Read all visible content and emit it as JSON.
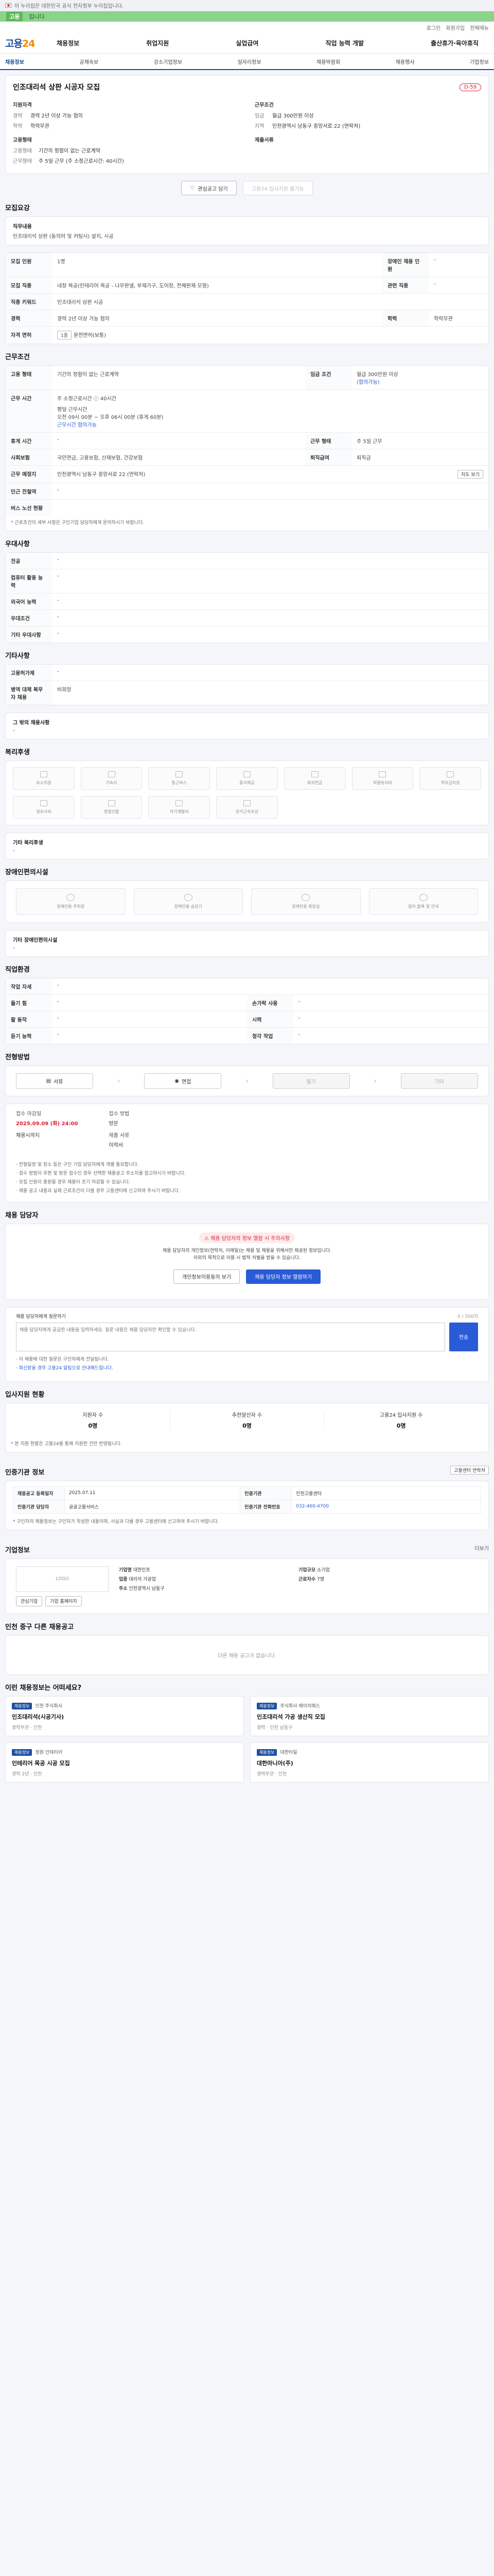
{
  "gov_bar": {
    "text": "이 누리집은 대한민국 공식 전자정부 누리집입니다."
  },
  "stripe": {
    "label": "고용",
    "text": "입니다"
  },
  "utility": {
    "links": [
      "로그인",
      "회원가입",
      "전체메뉴"
    ]
  },
  "gnb": {
    "logo": "고용",
    "logo_num": "24",
    "menu": [
      "채용정보",
      "취업지원",
      "실업급여",
      "직업 능력 개발",
      "출산휴가·육아휴직"
    ]
  },
  "sub_tabs": [
    "채용정보",
    "공채속보",
    "강소기업정보",
    "일자리정보",
    "채용박람회",
    "채용행사",
    "기업정보"
  ],
  "posting": {
    "title": "인조대리석 상판 시공자 모집",
    "dday": "D-59",
    "qual_head": "지원자격",
    "work_head": "근무조건",
    "company_head": "고용형태",
    "place_head": "제출서류",
    "qual": [
      {
        "k": "경력",
        "v": "경력 2년 이상 가능 협의"
      },
      {
        "k": "학력",
        "v": "학력무관"
      }
    ],
    "work": [
      {
        "k": "임금",
        "v": "월급 300만원 이상"
      },
      {
        "k": "지역",
        "v": "인천광역시 남동구 중앙서로 22 (연락처)"
      }
    ],
    "emp": [
      {
        "k": "고용형태",
        "v": "기간의 정함이 없는 근로계약"
      },
      {
        "k": "근무형태",
        "v": "주 5일 근무 (주 소정근로시간: 40시간)"
      }
    ],
    "buttons": {
      "scrap": "관심공고 담기",
      "apply": "고용24 입사지원 불가능"
    }
  },
  "recruit": {
    "section": "모집요강",
    "job_lbl": "직무내용",
    "job_val": "인조대리석 상판 (동의어 및 커팅시) 설치, 시공",
    "rows": [
      {
        "k": "모집 인원",
        "v": "1명",
        "k2": "장애인 채용 인원",
        "v2": "-"
      },
      {
        "k": "모집 직종",
        "v": "내장 목공(인테리어 목공 - 나무판넬, 부재가구, 도어장, 전체판재 모형)",
        "k2": "관련 직종",
        "v2": "-"
      },
      {
        "k": "직종 키워드",
        "v": "인조대리석 상판 시공",
        "k2": "",
        "v2": ""
      },
      {
        "k": "경력",
        "v": "경력 2년 이상 가능 협의",
        "k2": "학력",
        "v2": "학력무관"
      },
      {
        "k": "자격 면허",
        "v": "운전면허(보통)",
        "k2": "",
        "v2": ""
      }
    ]
  },
  "conditions": {
    "section": "근무조건",
    "emp_type_k": "고용 형태",
    "emp_type_v": "기간의 정함이 없는 근로계약",
    "wage_k": "임금 조건",
    "wage_v": "월급 300만원 이상",
    "wage_note": "(협의가능)",
    "time_k": "근무 시간",
    "time_lines": [
      "주 소정근로시간 ⓘ 40시간",
      "평일 근무시간",
      "오전 09시 00분 ~ 오후 06시 00분 (휴게 60분)",
      "근무시간 협의가능"
    ],
    "social_k": "휴게 시간",
    "social_v": "-",
    "workday_k": "근무 형태",
    "workday_v": "주 5일 근무",
    "insurance_k": "사회보험",
    "insurance_v": "국민연금, 고용보험, 산재보험, 건강보험",
    "retire_k": "퇴직급여",
    "retire_v": "퇴직금",
    "place_k": "근무 예정지",
    "place_v": "인천광역시 남동구 중앙서로 22 (연락처)",
    "map_btn": "지도 보기",
    "nearby_k": "인근 전철역",
    "nearby_v": "-",
    "bus_k": "버스 노선 현황",
    "note": "* 근로조건의 세부 사항은 구인기업 담당자에게 문의하시기 바랍니다."
  },
  "preferred": {
    "section": "우대사항",
    "rows": [
      {
        "k": "전공",
        "v": "-"
      },
      {
        "k": "컴퓨터 활용 능력",
        "v": "-"
      },
      {
        "k": "외국어 능력",
        "v": "-"
      },
      {
        "k": "우대조건",
        "v": "-"
      },
      {
        "k": "기타 우대사항",
        "v": "-"
      }
    ]
  },
  "etc": {
    "section": "기타사항",
    "rows": [
      {
        "k": "고용허가제",
        "v": "-"
      },
      {
        "k": "병역 대체 복무자 채용",
        "v": "비희망"
      }
    ],
    "extra_lbl": "그 밖의 채용사항",
    "extra_val": "-"
  },
  "benefits": {
    "section": "복리후생",
    "items": [
      "숙소지원",
      "기숙사",
      "통근버스",
      "중식제공",
      "퇴직연금",
      "차량유지비",
      "학자금지원",
      "경조사비",
      "명절선물",
      "자기계발비",
      "장기근속포상",
      "",
      "",
      ""
    ],
    "other_lbl": "기타 복리후생",
    "other_val": "-"
  },
  "disability": {
    "section": "장애인편의시설",
    "items": [
      "장애인용 주차장",
      "장애인용 승강기",
      "장애인용 화장실",
      "점자 블록 및 안내"
    ],
    "other_lbl": "기타 장애인편의시설",
    "other_val": "-"
  },
  "support": {
    "section": "직업환경",
    "rows": [
      {
        "k": "작업 자세",
        "v": "-",
        "k2": "",
        "v2": ""
      },
      {
        "k": "들기 힘",
        "v": "-",
        "k2": "손가락 사용",
        "v2": "-"
      },
      {
        "k": "팔 동작",
        "v": "-",
        "k2": "시력",
        "v2": "-"
      },
      {
        "k": "듣기 능력",
        "v": "-",
        "k2": "청각 작업",
        "v2": "-"
      }
    ]
  },
  "process": {
    "section": "전형방법",
    "steps": [
      "서류",
      "면접",
      "필기",
      "기타"
    ],
    "period_k": "접수 마감일",
    "period_v": "2025.09.09 (화) 24:00",
    "period_sub": "채용시까지",
    "method_k": "접수 방법",
    "method_v": "방문",
    "docs_k": "제출 서류",
    "docs_v": "이력서",
    "bullets": [
      "· 전형일정 및 장소 등은 구인 기업 담당자에게 개별 통보합니다.",
      "· 접수 방법이 우편 및 방문 접수인 경우 선택한 채용공고 주소지를 참고하시기 바랍니다.",
      "· 모집 인원이 충원될 경우 채용이 조기 마감될 수 있습니다.",
      "· 채용 공고 내용과 실제 근로조건이 다를 경우 고용센터에 신고하여 주시기 바랍니다."
    ]
  },
  "manager": {
    "section": "채용 담당자",
    "alert": "채용 담당자의 정보 열람 시 주의사항",
    "lines": [
      "채용 담당자의 개인정보(연락처, 이메일)는 채용 및 채용을 위해서만 제공된 정보입니다.",
      "이외의 목적으로 이용 시 법적 처벌을 받을 수 있습니다."
    ],
    "btn_view": "개인정보이용동의 보기",
    "btn_confirm": "채용 담당자 정보 열람하기"
  },
  "inquiry": {
    "label": "채용 담당자에게 질문하기",
    "count": "0 / 500자",
    "placeholder": "채용 담당자에게 궁금한 내용을 입력하세요. 질문 내용은 채용 담당자만 확인할 수 있습니다.",
    "send": "전송",
    "notes": [
      "· 이 채용에 대한 질문은 구인자에게 전달됩니다.",
      "· 회신받을 경우 고용24 알림으로 안내해드립니다."
    ]
  },
  "apply_status": {
    "section": "입사지원 현황",
    "cells": [
      {
        "k": "지원자 수",
        "v": "0명"
      },
      {
        "k": "추천알선자 수",
        "v": "0명"
      },
      {
        "k": "고용24 입사지원 수",
        "v": "0명"
      }
    ],
    "note": "* 본 지원 현황은 고용24를 통해 지원한 건만 반영됩니다."
  },
  "company_info": {
    "section": "인증기관 정보",
    "btn": "고용센터 연락처",
    "rows": [
      {
        "k": "채용공고 등록일자",
        "v": "2025.07.11",
        "k2": "인증기관",
        "v2": "인천고용센터"
      },
      {
        "k": "인증기관 담당자",
        "v": "공공고용서비스",
        "k2": "인증기관 전화번호",
        "v2": "032-460-4700"
      }
    ],
    "note": "* 구인자의 채용정보는 구인자가 작성한 내용이며, 사실과 다를 경우 고용센터에 신고하여 주시기 바랍니다."
  },
  "corp": {
    "section": "기업정보",
    "more": "더보기",
    "logo": "LOGO",
    "name_k": "기업명",
    "name_v": "대한인조",
    "industry_k": "업종",
    "industry_v": "대리석 가공업",
    "size_k": "기업규모",
    "size_v": "소기업",
    "emp_k": "근로자수",
    "emp_v": "7명",
    "address_k": "주소",
    "address_v": "인천광역시 남동구",
    "btn_follow": "관심기업",
    "btn_page": "기업 홈페이지"
  },
  "related": {
    "section": "인천 중구 다른 채용공고",
    "empty": "다른 채용 공고가 없습니다."
  },
  "others": {
    "section": "이런 채용정보는 어떠세요?",
    "items": [
      {
        "badge": "채용정보",
        "company": "인천 주식회사",
        "title": "인조대리석(시공기사)",
        "meta": "경력무관 · 인천"
      },
      {
        "badge": "채용정보",
        "company": "주식회사 에이치에스",
        "title": "인조대리석 가공 생산직 모집",
        "meta": "경력 · 인천 남동구"
      },
      {
        "badge": "채용정보",
        "company": "정원 인테리어",
        "title": "인테리어 목공 시공 모집",
        "meta": "경력 2년 · 인천"
      },
      {
        "badge": "채용정보",
        "company": "대한타일",
        "title": "대한마니아(주)",
        "meta": "경력무관 · 인천"
      }
    ]
  }
}
